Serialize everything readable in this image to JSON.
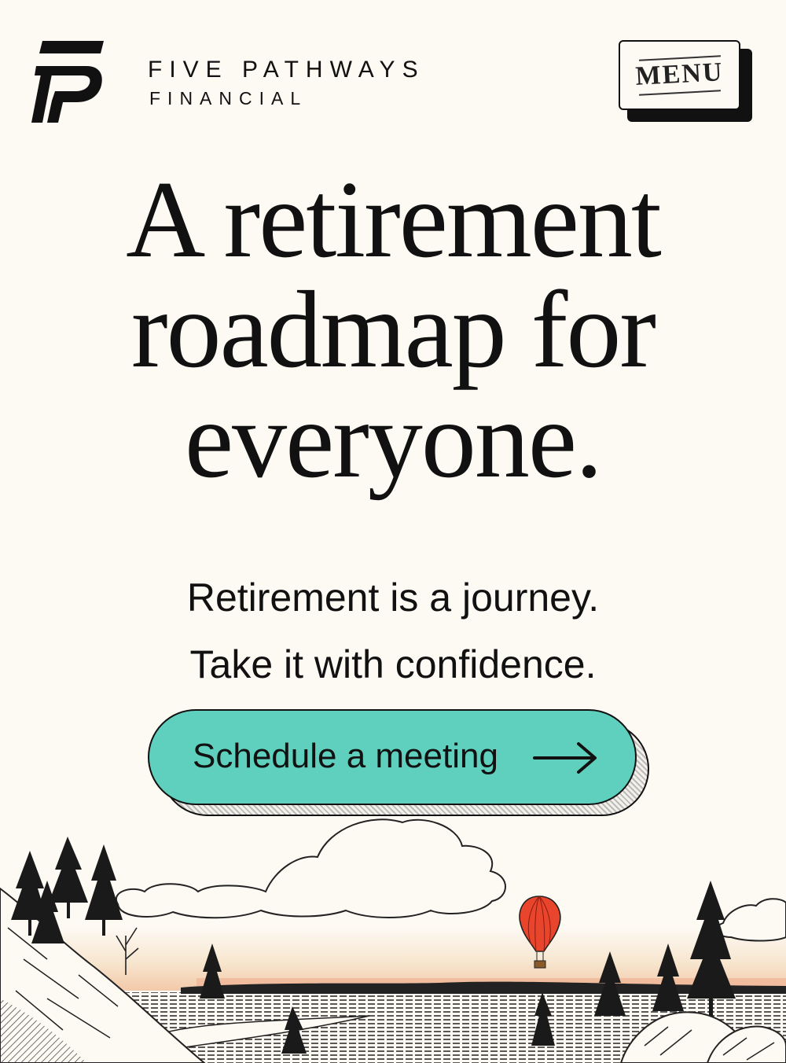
{
  "header": {
    "brand_name": "FIVE PATHWAYS",
    "brand_sub": "FINANCIAL",
    "logo_icon": "five-pathways-logo",
    "menu_label": "MENU"
  },
  "hero": {
    "title_lines": [
      "A retirement",
      "roadmap for",
      "everyone."
    ],
    "tagline_lines": [
      "Retirement is a journey.",
      "Take it with confidence."
    ]
  },
  "cta": {
    "label": "Schedule a meeting",
    "icon": "arrow-right-icon",
    "color": "#5fd0bd"
  },
  "colors": {
    "background": "#fdf9f3",
    "text": "#111111",
    "accent": "#5fd0bd",
    "balloon": "#e8452c"
  }
}
